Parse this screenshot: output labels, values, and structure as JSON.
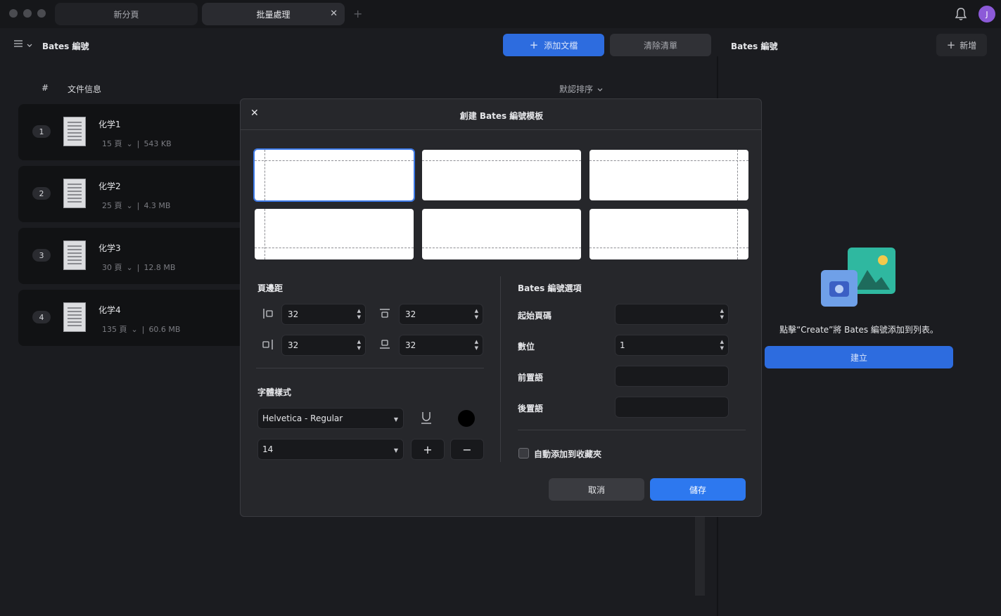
{
  "tabs": [
    {
      "label": "新分頁",
      "active": false
    },
    {
      "label": "批量處理",
      "active": true
    }
  ],
  "user": {
    "initial": "J"
  },
  "left_panel": {
    "title": "Bates 編號",
    "add_doc_label": "添加文檔",
    "clear_label": "清除清單",
    "col_hash": "#",
    "col_info": "文件信息",
    "sort_label": "默認排序",
    "documents": [
      {
        "num": "1",
        "name": "化学1",
        "pages": "15 頁",
        "size": "543 KB"
      },
      {
        "num": "2",
        "name": "化学2",
        "pages": "25 頁",
        "size": "4.3 MB"
      },
      {
        "num": "3",
        "name": "化学3",
        "pages": "30 頁",
        "size": "12.8 MB"
      },
      {
        "num": "4",
        "name": "化学4",
        "pages": "135 頁",
        "size": "60.6 MB"
      }
    ]
  },
  "right_panel": {
    "title": "Bates 編號",
    "new_label": "新增",
    "empty_text": "點擊“Create”將 Bates 編號添加到列表。",
    "create_label": "建立"
  },
  "modal": {
    "title": "創建 Bates 編號模板",
    "margins_label": "頁邊距",
    "margin_left": "32",
    "margin_top": "32",
    "margin_right": "32",
    "margin_bottom": "32",
    "font_style_label": "字體樣式",
    "font": "Helvetica - Regular",
    "font_size": "14",
    "font_color": "#000000",
    "options_label": "Bates 編號選項",
    "start_page_label": "起始頁碼",
    "start_page_value": "",
    "digits_label": "數位",
    "digits_value": "1",
    "prefix_label": "前置語",
    "prefix_value": "",
    "suffix_label": "後置語",
    "suffix_value": "",
    "auto_add_label": "自動添加到收藏夾",
    "cancel_label": "取消",
    "save_label": "儲存"
  },
  "colors": {
    "accent": "#2d6cdf",
    "background": "#1b1c20",
    "modal": "#26272b"
  }
}
